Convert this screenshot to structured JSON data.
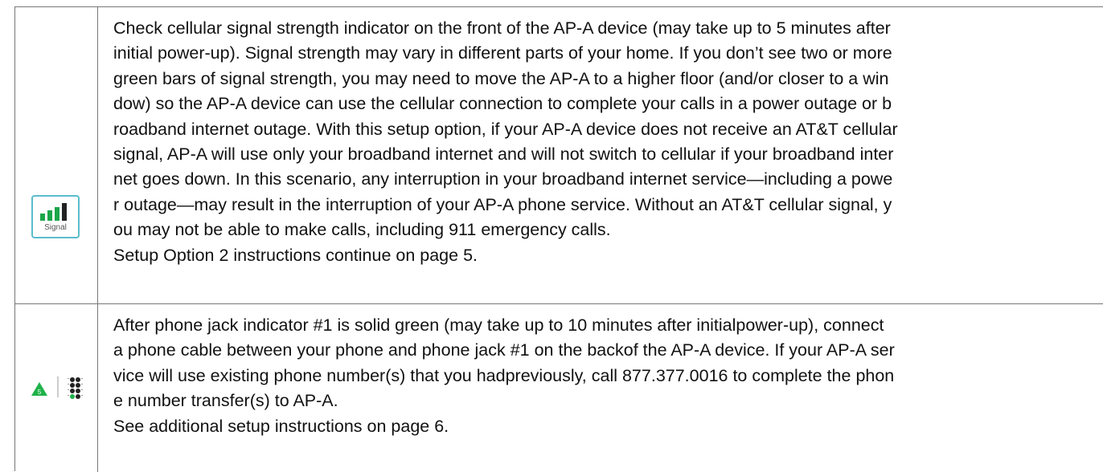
{
  "rows": [
    {
      "icon": "signal-strength-icon",
      "icon_label": "Signal",
      "text": "Check cellular signal strength indicator on the front of the AP-A device (may take up to 5 minutes after\ninitial power-up). Signal strength may vary in different parts of your home. If you don’t see two or more\ngreen bars of signal strength, you may need to move the AP-A to a higher floor (and/or closer to a win\ndow) so the AP-A device can use the cellular connection to complete your calls in a power outage or b\nroadband internet outage. With this setup option, if your AP-A device does not receive an AT&T cellular\nsignal, AP-A will use only your broadband internet and will not switch to cellular if your broadband inter\nnet goes down. In this scenario, any interruption in your broadband internet service—including a powe\nr outage—may result in the interruption of your AP-A phone service. Without an AT&T cellular signal, y\nou may not be able to make calls, including 911 emergency calls.\nSetup Option 2 instructions continue on page 5."
    },
    {
      "step_number": "5",
      "icon": "phone-jack-indicator-icon",
      "text": "After phone jack indicator #1 is solid green (may take up to 10 minutes after initialpower-up), connect\na phone cable between your phone and phone jack #1 on the backof the AP-A device. If your AP-A ser\nvice will use existing phone number(s) that you hadpreviously, call 877.377.0016 to complete the phon\ne number transfer(s) to AP-A.\nSee additional setup instructions on page 6."
    }
  ],
  "colors": {
    "border": "#777777",
    "signal_box_border": "#5bbccd",
    "signal_bar_green": "#1aa64a",
    "signal_bar_dark": "#222222",
    "step_triangle": "#1fb24a"
  }
}
